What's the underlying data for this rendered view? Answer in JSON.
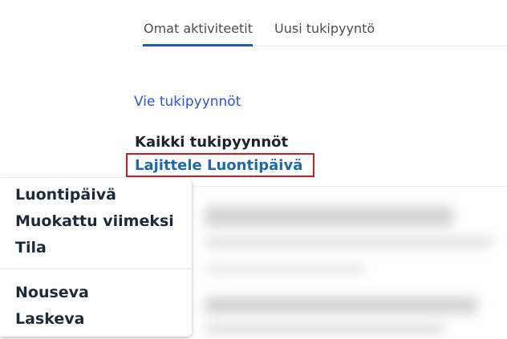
{
  "tabs": [
    {
      "label": "Omat aktiviteetit",
      "active": true
    },
    {
      "label": "Uusi tukipyyntö",
      "active": false
    }
  ],
  "export_link": "Vie tukipyynnöt",
  "list_title": "Kaikki tukipyynnöt",
  "sort_toggle": "Lajittele Luontipäivä",
  "sort_menu": {
    "fields": [
      "Luontipäivä",
      "Muokattu viimeksi",
      "Tila"
    ],
    "orders": [
      "Nouseva",
      "Laskeva"
    ]
  },
  "colors": {
    "accent": "#1a5fb4",
    "link": "#2b55d8",
    "highlight_border": "#d01c1c",
    "sort_text": "#1e6aa6"
  }
}
